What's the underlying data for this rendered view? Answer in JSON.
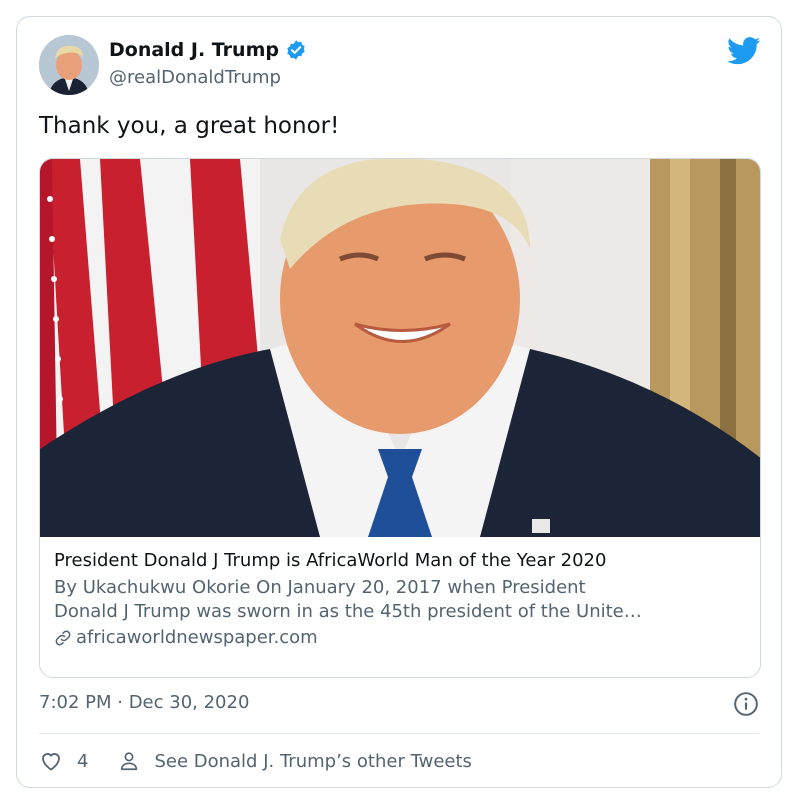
{
  "user": {
    "name": "Donald J. Trump",
    "handle": "@realDonaldTrump",
    "verified": true
  },
  "tweet": {
    "text": "Thank you, a great honor!",
    "timestamp": "7:02 PM · Dec 30, 2020",
    "like_count": "4",
    "other_tweets_label": "See Donald J. Trump’s other Tweets"
  },
  "link_card": {
    "title": "President Donald J Trump is AfricaWorld Man of the Year 2020",
    "description_line1": "By Ukachukwu Okorie On January 20, 2017 when President",
    "description_line2": "Donald J Trump was sworn in as the 45th president of the Unite…",
    "domain": "africaworldnewspaper.com"
  },
  "icons": {
    "brand": "twitter-bird-icon",
    "verified": "verified-badge-icon",
    "link": "link-icon",
    "info": "info-icon",
    "like": "heart-icon",
    "profile": "person-icon"
  },
  "colors": {
    "twitter_blue": "#1d9bf0",
    "text_primary": "#0f1419",
    "text_secondary": "#536471",
    "border": "#cfd9de"
  }
}
